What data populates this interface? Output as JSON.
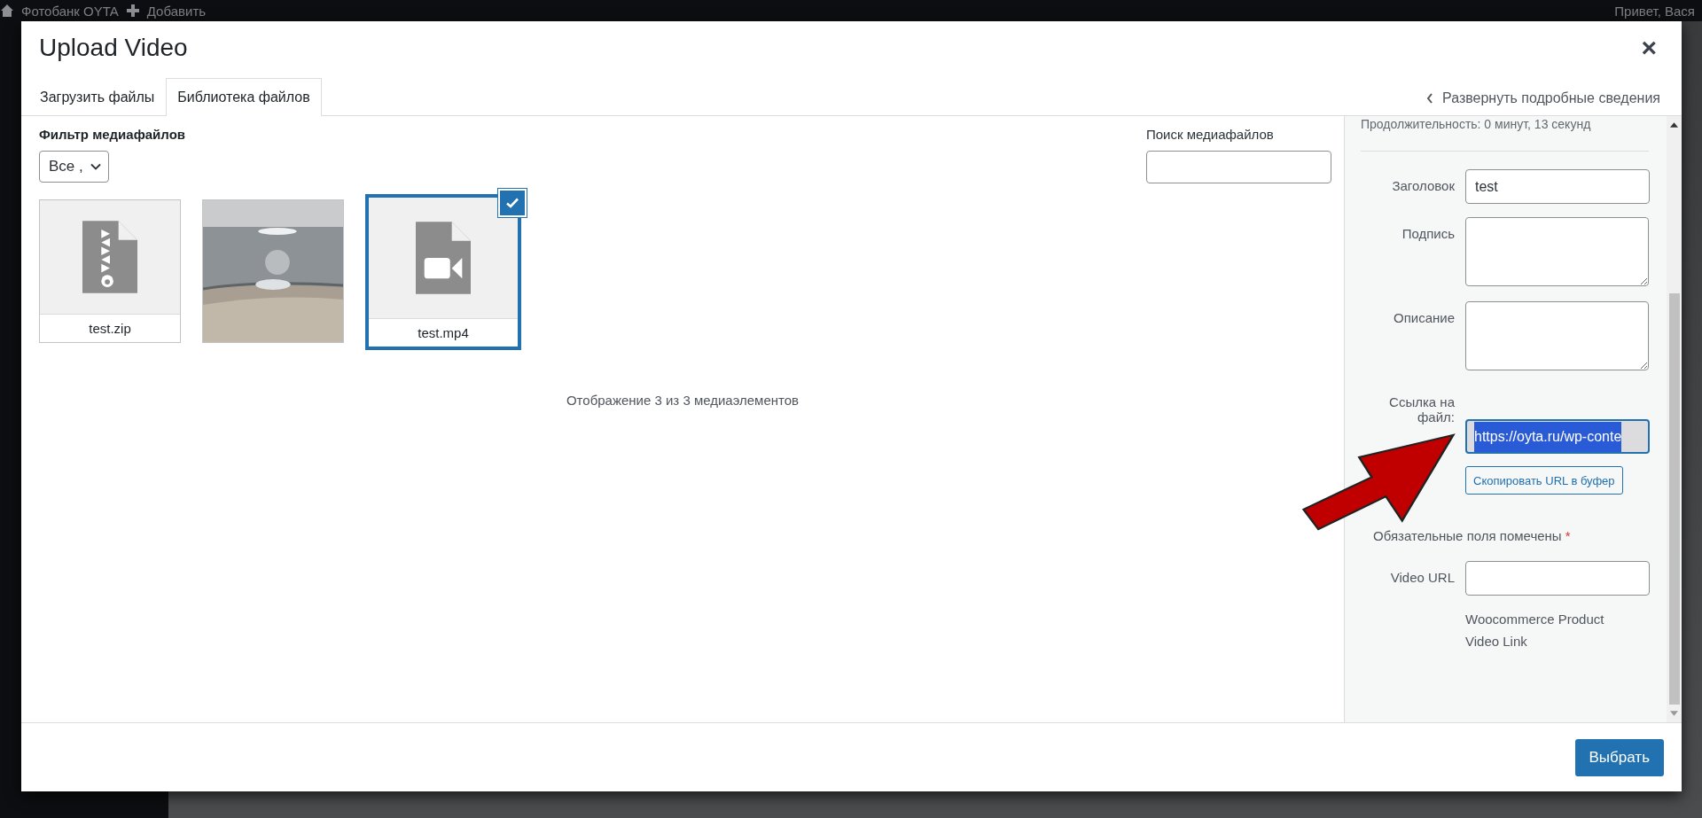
{
  "admin_bar": {
    "site": "Фотобанк OYTA",
    "add": "Добавить",
    "greeting": "Привет, Вася"
  },
  "modal": {
    "title": "Upload Video",
    "close": "×"
  },
  "tabs": [
    {
      "label": "Загрузить файлы",
      "selected": false
    },
    {
      "label": "Библиотека файлов",
      "selected": true
    }
  ],
  "details_toggle": "Развернуть подробные сведения",
  "filter": {
    "label": "Фильтр медиафайлов",
    "value": "Все ,"
  },
  "search": {
    "label": "Поиск медиафайлов"
  },
  "media": [
    {
      "kind": "zip",
      "name": "test.zip",
      "selected": false
    },
    {
      "kind": "picture",
      "selected": false
    },
    {
      "kind": "video",
      "name": "test.mp4",
      "selected": true
    }
  ],
  "status": "Отображение 3 из 3 медиаэлементов",
  "details": {
    "duration": "Продолжительность: 0 минут, 13 секунд",
    "fields": [
      {
        "kind": "input",
        "label": "Заголовок",
        "value": "test"
      },
      {
        "kind": "textarea",
        "label": "Подпись"
      },
      {
        "kind": "textarea",
        "label": "Описание"
      },
      {
        "kind": "selected-input",
        "label": "Ссылка на файл:",
        "value": "https://oyta.ru/wp-conte"
      }
    ],
    "copy_button": "Скопировать URL в буфер",
    "required_note": "Обязательные поля помечены",
    "required_mark": "*",
    "video_url": {
      "label": "Video URL"
    },
    "help": "Woocommerce Product Video Link"
  },
  "select_button": "Выбрать"
}
